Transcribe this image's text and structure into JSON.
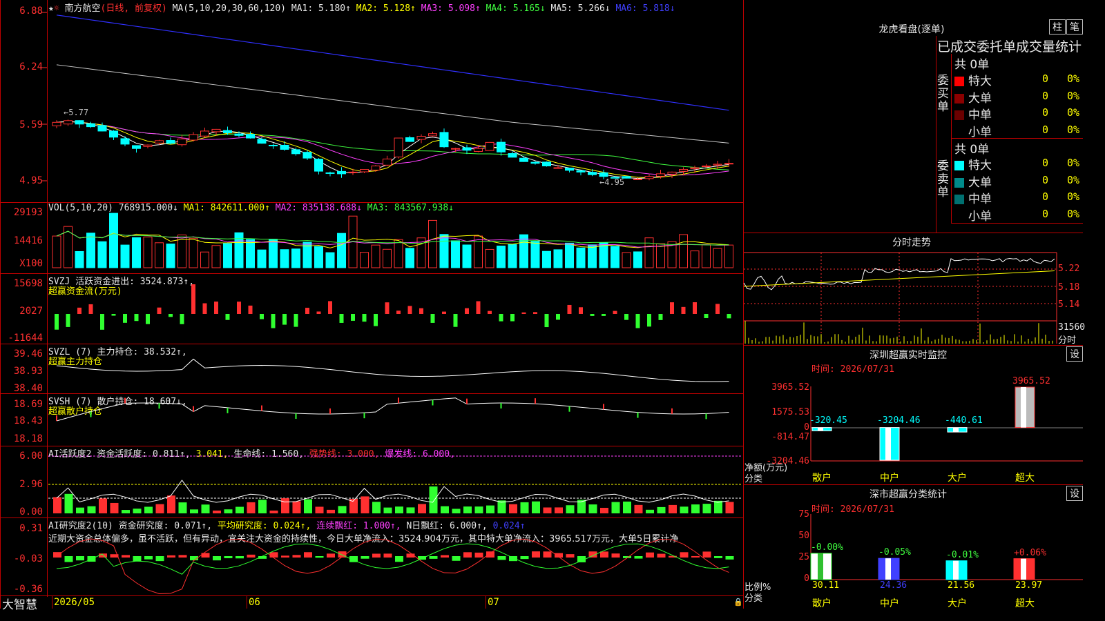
{
  "stock": {
    "name": "南方航空",
    "period": "(日线, 前复权)"
  },
  "ma_header": {
    "label": "MA(5,10,20,30,60,120)",
    "items": [
      {
        "text": "MA1: 5.180↑",
        "color": "#e8e8e8"
      },
      {
        "text": "MA2: 5.128↑",
        "color": "#ffff00"
      },
      {
        "text": "MA3: 5.098↑",
        "color": "#ff40ff"
      },
      {
        "text": "MA4: 5.165↓",
        "color": "#40ff40"
      },
      {
        "text": "MA5: 5.266↓",
        "color": "#e8e8e8"
      },
      {
        "text": "MA6: 5.818↓",
        "color": "#4040ff"
      }
    ]
  },
  "price_axis": [
    "6.88",
    "6.24",
    "5.59",
    "4.95"
  ],
  "price_annotations": {
    "high": "5.77",
    "low": "4.95"
  },
  "vol_header": {
    "label": "VOL(5,10,20)",
    "value": "768915.000↓",
    "ma1": "MA1: 842611.000↑",
    "ma2": "MA2: 835138.688↓",
    "ma3": "MA3: 843567.938↓"
  },
  "vol_axis": [
    "29193",
    "14416",
    "X100"
  ],
  "svzj": {
    "title": "SVZJ  活跃资金进出: 3524.873↑,",
    "sub": "超赢资金流(万元)",
    "axis": [
      "15698",
      "2027",
      "-11644"
    ]
  },
  "svzl": {
    "title": "SVZL (7) 主力持仓: 38.532↑,",
    "sub": "超赢主力持仓",
    "axis": [
      "39.46",
      "38.93",
      "38.40"
    ]
  },
  "svsh": {
    "title": "SVSH (7) 散户持仓: 18.607↓,",
    "sub": "超赢散户持仓",
    "axis": [
      "18.69",
      "18.43",
      "18.18"
    ]
  },
  "ai1": {
    "name": "AI活跃度2",
    "parts": [
      {
        "text": "资金活跃度: 0.811↑,",
        "color": "#e8e8e8"
      },
      {
        "text": "3.041,",
        "color": "#ffff00"
      },
      {
        "text": "生命线: 1.560,",
        "color": "#e8e8e8"
      },
      {
        "text": "强势线: 3.000,",
        "color": "#ff3030"
      },
      {
        "text": "爆发线: 6.000,",
        "color": "#ff40ff"
      }
    ],
    "axis": [
      "6.00",
      "2.96",
      "0.00"
    ]
  },
  "ai2": {
    "name": "AI研究度2(10)",
    "parts": [
      {
        "text": "资金研究度: 0.071↑,",
        "color": "#e8e8e8"
      },
      {
        "text": "平均研究度: 0.024↑,",
        "color": "#ffff00"
      },
      {
        "text": "连续飘红: 1.000↑,",
        "color": "#ff40ff"
      },
      {
        "text": "N日飘红: 6.000↑,",
        "color": "#e8e8e8"
      },
      {
        "text": "0.024↑",
        "color": "#4040ff"
      }
    ],
    "desc": "近期大资金总体偏多，虽不活跃，但有异动，宜关注大资金的持续性，今日大单净流入：3524.904万元，其中特大单净流入：3965.517万元，大单5日累计净",
    "axis": [
      "0.31",
      "-0.03",
      "-0.36"
    ]
  },
  "bottom": {
    "brand": "大智慧",
    "dates": [
      "2026/05",
      "06",
      "07"
    ]
  },
  "lhkp": {
    "title": "龙虎看盘(逐单)",
    "tabs": [
      "柱",
      "笔"
    ],
    "heading": "已成交委托单成交量统计",
    "buy": {
      "label": "委买单",
      "total": "共 0单",
      "rows": [
        {
          "name": "特大",
          "val": "0",
          "pct": "0%",
          "color": "#ff0000"
        },
        {
          "name": "大单",
          "val": "0",
          "pct": "0%",
          "color": "#8b0000"
        },
        {
          "name": "中单",
          "val": "0",
          "pct": "0%",
          "color": "#6b0000"
        },
        {
          "name": "小单",
          "val": "0",
          "pct": "0%",
          "color": "#000000"
        }
      ]
    },
    "sell": {
      "label": "委卖单",
      "total": "共 0单",
      "rows": [
        {
          "name": "特大",
          "val": "0",
          "pct": "0%",
          "color": "#00ffff"
        },
        {
          "name": "大单",
          "val": "0",
          "pct": "0%",
          "color": "#008b8b"
        },
        {
          "name": "中单",
          "val": "0",
          "pct": "0%",
          "color": "#007070"
        },
        {
          "name": "小单",
          "val": "0",
          "pct": "0%",
          "color": "#000000"
        }
      ]
    }
  },
  "fsz": {
    "title": "分时走势",
    "axis": [
      "5.22",
      "5.18",
      "5.14",
      "31560"
    ],
    "unit": "分时"
  },
  "szjk": {
    "title": "深圳超赢实时监控",
    "btn": "设",
    "time": "时间: 2026/07/31",
    "axis": [
      "3965.52",
      "1575.53",
      "0",
      "-814.47",
      "-3204.46"
    ],
    "ylabel": "净额(万元)",
    "xlabel": "分类",
    "cats": [
      "散户",
      "中户",
      "大户",
      "超大"
    ],
    "values": [
      -320.45,
      -3204.46,
      -440.61,
      3965.52
    ],
    "labels": [
      "-320.45",
      "-3204.46",
      "-440.61",
      "3965.52"
    ]
  },
  "fltj": {
    "title": "深市超赢分类统计",
    "btn": "设",
    "time": "时间: 2026/07/31",
    "axis": [
      "75",
      "50",
      "25",
      "0"
    ],
    "ylabel": "比例%",
    "xlabel": "分类",
    "cats": [
      "散户",
      "中户",
      "大户",
      "超大"
    ],
    "values": [
      30.11,
      24.36,
      21.56,
      23.97
    ],
    "labels": [
      "30.11",
      "24.36",
      "21.56",
      "23.97"
    ],
    "changes": [
      "-0.00%",
      "-0.05%",
      "-0.01%",
      "+0.06%"
    ]
  },
  "chart_data": [
    {
      "type": "bar",
      "title": "深圳超赢实时监控",
      "ylabel": "净额(万元)",
      "categories": [
        "散户",
        "中户",
        "大户",
        "超大"
      ],
      "values": [
        -320.45,
        -3204.46,
        -440.61,
        3965.52
      ],
      "ylim": [
        -3204.46,
        3965.52
      ]
    },
    {
      "type": "bar",
      "title": "深市超赢分类统计",
      "ylabel": "比例%",
      "categories": [
        "散户",
        "中户",
        "大户",
        "超大"
      ],
      "values": [
        30.11,
        24.36,
        21.56,
        23.97
      ],
      "ylim": [
        0,
        75
      ]
    }
  ]
}
